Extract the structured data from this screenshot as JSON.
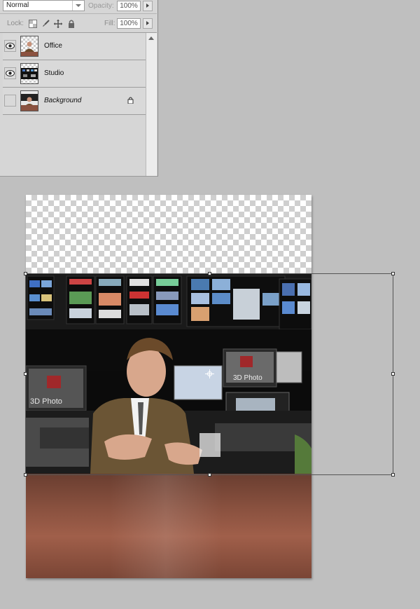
{
  "layers_panel": {
    "blend_mode": "Normal",
    "opacity_label": "Opacity:",
    "opacity_value": "100%",
    "lock_label": "Lock:",
    "fill_label": "Fill:",
    "fill_value": "100%",
    "layers": [
      {
        "name": "Office",
        "visible": true,
        "locked": false
      },
      {
        "name": "Studio",
        "visible": true,
        "locked": false
      },
      {
        "name": "Background",
        "visible": false,
        "locked": true
      }
    ]
  },
  "canvas": {
    "monitor_text_left": "3D Photo",
    "monitor_text_right": "3D Photo"
  },
  "colors": {
    "panel_bg": "#d6d6d6",
    "workspace_bg": "#bfbfbf",
    "table_wood": "#8b5240"
  }
}
